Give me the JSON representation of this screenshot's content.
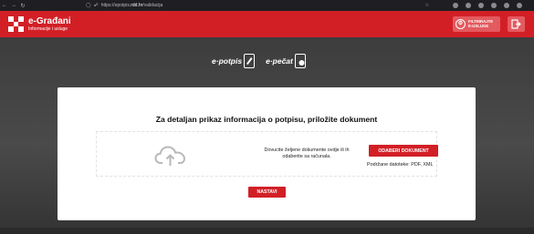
{
  "browser": {
    "back_icon": "arrow-left-icon",
    "forward_icon": "arrow-right-icon",
    "reload_icon": "reload-icon",
    "url_prefix": "https://epotpis.",
    "url_domain": "rdd.hr",
    "url_suffix": "/validacija"
  },
  "header": {
    "brand_title": "e-Građani",
    "brand_subtitle": "Informacije i usluge",
    "filter_label_line1": "FILTRIRAJTE",
    "filter_label_line2": "E-USLUGE"
  },
  "services": [
    {
      "name": "potpis",
      "prefix": "e"
    },
    {
      "name": "pečat",
      "prefix": "e"
    }
  ],
  "card": {
    "title": "Za detaljan prikaz informacija o potpisu, priložite dokument",
    "drop_text": "Dovucite željene dokumente ovdje ili ih odaberite sa računala.",
    "choose_button": "ODABERI DOKUMENT",
    "supported_formats": "Podržane datoteke: PDF, XML",
    "continue_button": "NASTAVI"
  },
  "colors": {
    "brand_red": "#d21f26",
    "button_light_red": "#e35a5f"
  }
}
